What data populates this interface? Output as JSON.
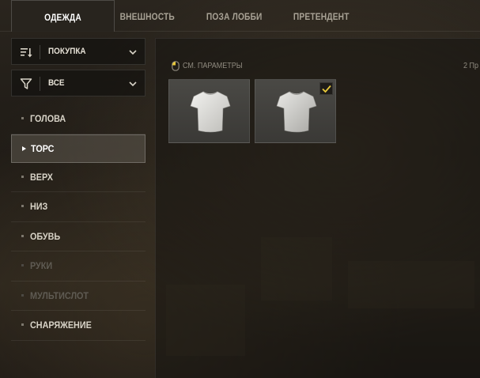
{
  "tabs": [
    {
      "label": "ОДЕЖДА",
      "active": true
    },
    {
      "label": "ВНЕШНОСТЬ",
      "active": false
    },
    {
      "label": "ПОЗА ЛОББИ",
      "active": false
    },
    {
      "label": "ПРЕТЕНДЕНТ",
      "active": false
    }
  ],
  "filters": {
    "sort": {
      "label": "ПОКУПКА",
      "icon": "sort-icon"
    },
    "filter": {
      "label": "ВСЕ",
      "icon": "filter-icon"
    }
  },
  "categories": [
    {
      "label": "ГОЛОВА",
      "state": "normal"
    },
    {
      "label": "ТОРС",
      "state": "active"
    },
    {
      "label": "ВЕРХ",
      "state": "normal"
    },
    {
      "label": "НИЗ",
      "state": "normal"
    },
    {
      "label": "ОБУВЬ",
      "state": "normal"
    },
    {
      "label": "РУКИ",
      "state": "disabled"
    },
    {
      "label": "МУЛЬТИСЛОТ",
      "state": "disabled"
    },
    {
      "label": "СНАРЯЖЕНИЕ",
      "state": "normal"
    }
  ],
  "main": {
    "params_label": "СМ. ПАРАМЕТРЫ",
    "count_label": "2 Пр",
    "items": [
      {
        "name": "white-tshirt",
        "equipped": false
      },
      {
        "name": "white-tshirt-equipped",
        "equipped": true
      }
    ]
  },
  "colors": {
    "accent_check": "#e8c93a",
    "background": "#231f19"
  }
}
